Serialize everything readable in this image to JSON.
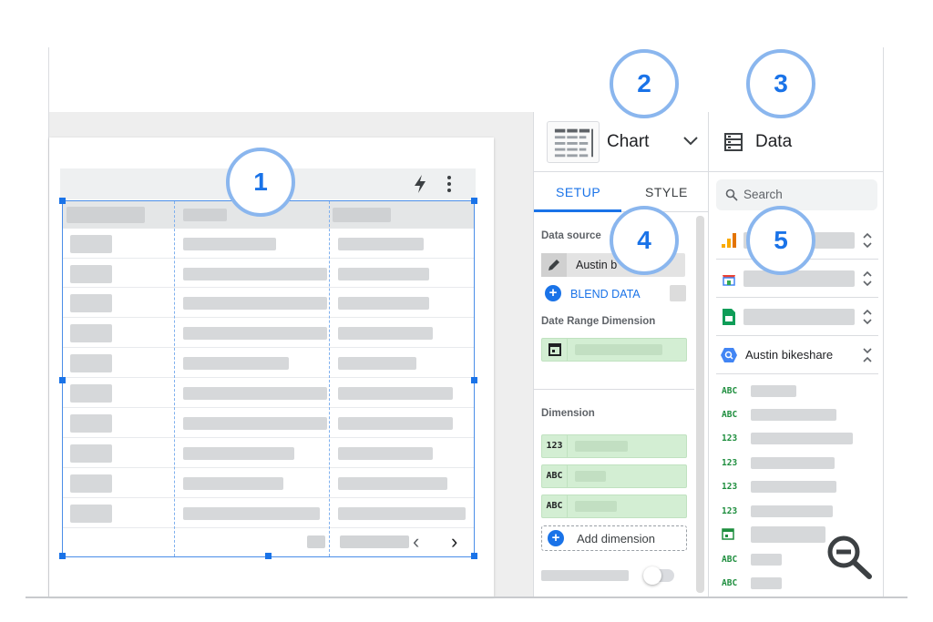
{
  "chart_panel": {
    "title": "Chart",
    "tabs": {
      "setup": "SETUP",
      "style": "STYLE"
    },
    "data_source_label": "Data source",
    "data_source_value": "Austin b",
    "blend_data": "BLEND DATA",
    "date_range_label": "Date Range Dimension",
    "dimension_label": "Dimension",
    "dimension_types": [
      "123",
      "ABC",
      "ABC"
    ],
    "add_dimension": "Add dimension"
  },
  "data_panel": {
    "title": "Data",
    "search_placeholder": "Search",
    "selected_source": "Austin bikeshare",
    "field_types": [
      "ABC",
      "ABC",
      "123",
      "123",
      "123",
      "123",
      "date",
      "ABC",
      "ABC"
    ]
  },
  "callouts": [
    "1",
    "2",
    "3",
    "4",
    "5"
  ],
  "icons": [
    "bolt-icon",
    "kebab-icon",
    "chevron-down-icon",
    "pencil-icon",
    "calendar-icon",
    "search-icon",
    "bar-chart-icon",
    "database-icon",
    "sheets-icon",
    "bigquery-icon",
    "zoom-out-icon"
  ],
  "colors": {
    "accent": "#1a73e8",
    "field_green": "#d3eed3",
    "callout_border": "#8ab6ee"
  }
}
